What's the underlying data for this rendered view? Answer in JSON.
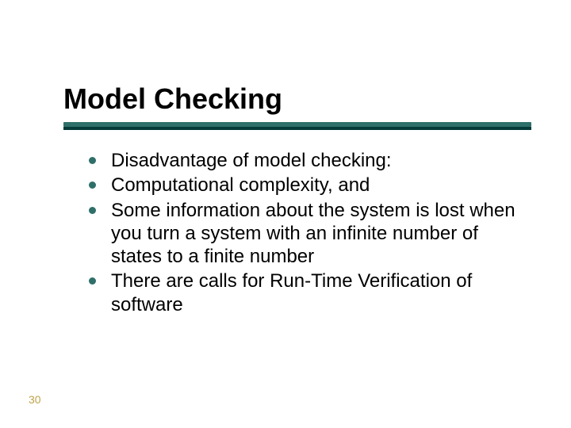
{
  "slide": {
    "title": "Model Checking",
    "bullets": [
      "Disadvantage of model checking:",
      "Computational complexity, and",
      "Some information about the system is lost when you turn a system with an infinite number of states to a finite number",
      "There are calls for Run-Time Verification of software"
    ],
    "page_number": "30"
  },
  "colors": {
    "accent": "#2f6f6a",
    "accent_dark": "#043a38",
    "page_number": "#bfa34a"
  }
}
